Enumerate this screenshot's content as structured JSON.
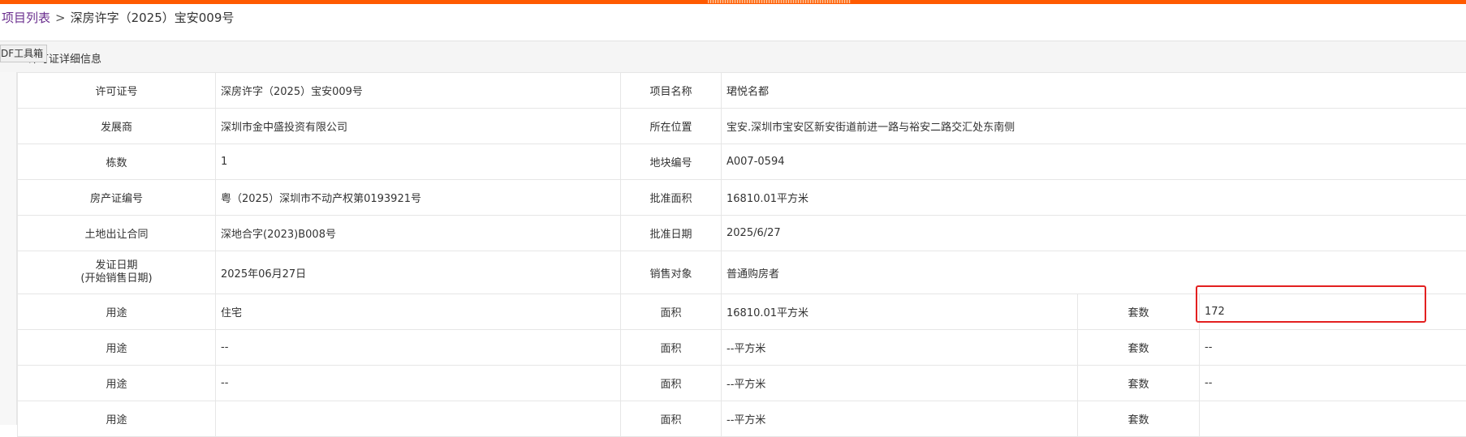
{
  "breadcrumb": {
    "root": "项目列表",
    "separator": ">",
    "current": "深房许字（2025）宝安009号"
  },
  "panel": {
    "title": "许可证详细信息"
  },
  "pdf_toolbar": {
    "label": "DF工具箱"
  },
  "colors": {
    "accent_bar": "#ff5a00",
    "link": "#6a2e8e",
    "highlight_box": "#e32020"
  },
  "details": {
    "license_no": {
      "label": "许可证号",
      "value": "深房许字（2025）宝安009号"
    },
    "project_name": {
      "label": "项目名称",
      "value": "珺悦名都"
    },
    "developer": {
      "label": "发展商",
      "value": "深圳市金中盛投资有限公司"
    },
    "location": {
      "label": "所在位置",
      "value": "宝安.深圳市宝安区新安街道前进一路与裕安二路交汇处东南侧"
    },
    "buildings": {
      "label": "栋数",
      "value": "1"
    },
    "plot_no": {
      "label": "地块编号",
      "value": "A007-0594"
    },
    "property_cert": {
      "label": "房产证编号",
      "value": "粤（2025）深圳市不动产权第0193921号"
    },
    "approved_area": {
      "label": "批准面积",
      "value": "16810.01平方米"
    },
    "land_contract": {
      "label": "土地出让合同",
      "value": "深地合字(2023)B008号"
    },
    "approved_date": {
      "label": "批准日期",
      "value": "2025/6/27"
    },
    "issue_date": {
      "label_line1": "发证日期",
      "label_line2": "(开始销售日期)",
      "value": "2025年06月27日"
    },
    "sale_target": {
      "label": "销售对象",
      "value": "普通购房者"
    }
  },
  "usage_rows": [
    {
      "use_label": "用途",
      "use_value": "住宅",
      "area_label": "面积",
      "area_value": "16810.01平方米",
      "units_label": "套数",
      "units_value": "172"
    },
    {
      "use_label": "用途",
      "use_value": "--",
      "area_label": "面积",
      "area_value": "--平方米",
      "units_label": "套数",
      "units_value": "--"
    },
    {
      "use_label": "用途",
      "use_value": "--",
      "area_label": "面积",
      "area_value": "--平方米",
      "units_label": "套数",
      "units_value": "--"
    },
    {
      "use_label": "用途",
      "use_value": "",
      "area_label": "面积",
      "area_value": "--平方米",
      "units_label": "套数",
      "units_value": ""
    }
  ]
}
